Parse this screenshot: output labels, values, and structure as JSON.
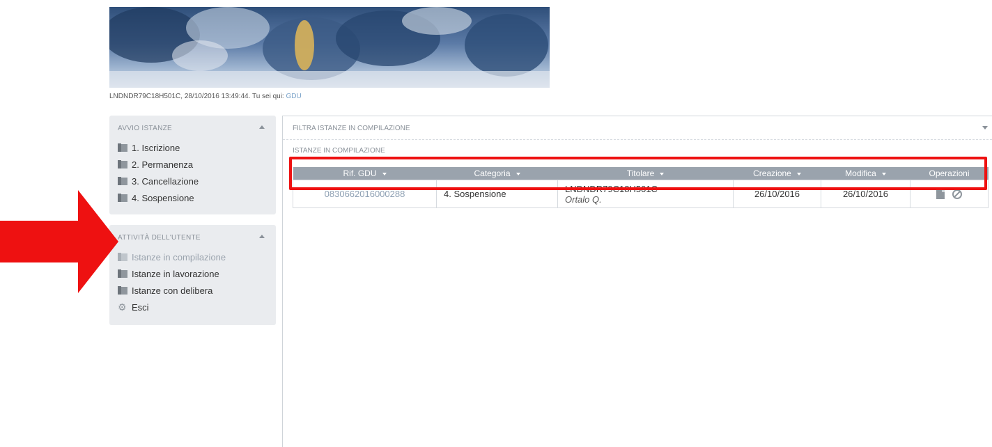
{
  "banner": {
    "alt": "decorative baroque fresco banner"
  },
  "userline": {
    "text": "LNDNDR79C18H501C, 28/10/2016 13:49:44. Tu sei qui:",
    "location": "GDU"
  },
  "sidebar": {
    "avvio": {
      "title": "AVVIO ISTANZE",
      "items": [
        {
          "label": "1. Iscrizione",
          "icon": "book-icon"
        },
        {
          "label": "2. Permanenza",
          "icon": "book-icon"
        },
        {
          "label": "3. Cancellazione",
          "icon": "book-icon"
        },
        {
          "label": "4. Sospensione",
          "icon": "book-icon"
        }
      ]
    },
    "attivita": {
      "title": "ATTIVITÀ DELL'UTENTE",
      "items": [
        {
          "label": "Istanze in compilazione",
          "icon": "book-icon",
          "active": true
        },
        {
          "label": "Istanze in lavorazione",
          "icon": "book-icon"
        },
        {
          "label": "Istanze con delibera",
          "icon": "book-icon"
        },
        {
          "label": "Esci",
          "icon": "gear-icon"
        }
      ]
    }
  },
  "main": {
    "filter_title": "FILTRA ISTANZE IN COMPILAZIONE",
    "section_title": "ISTANZE IN COMPILAZIONE",
    "table": {
      "headers": [
        "Rif. GDU",
        "Categoria",
        "Titolare",
        "Creazione",
        "Modifica",
        "Operazioni"
      ],
      "rows": [
        {
          "ref": "0830662016000288",
          "categoria": "4. Sospensione",
          "titolare": "LNDNDR79C18H501C",
          "titolare_sub": "Ortalo Q.",
          "creazione": "26/10/2016",
          "modifica": "26/10/2016"
        }
      ]
    }
  },
  "colors": {
    "highlight": "#ee1111",
    "arrow": "#ee1111",
    "table_header": "#9aa3ad",
    "sidebar_bg": "#eaecef"
  }
}
